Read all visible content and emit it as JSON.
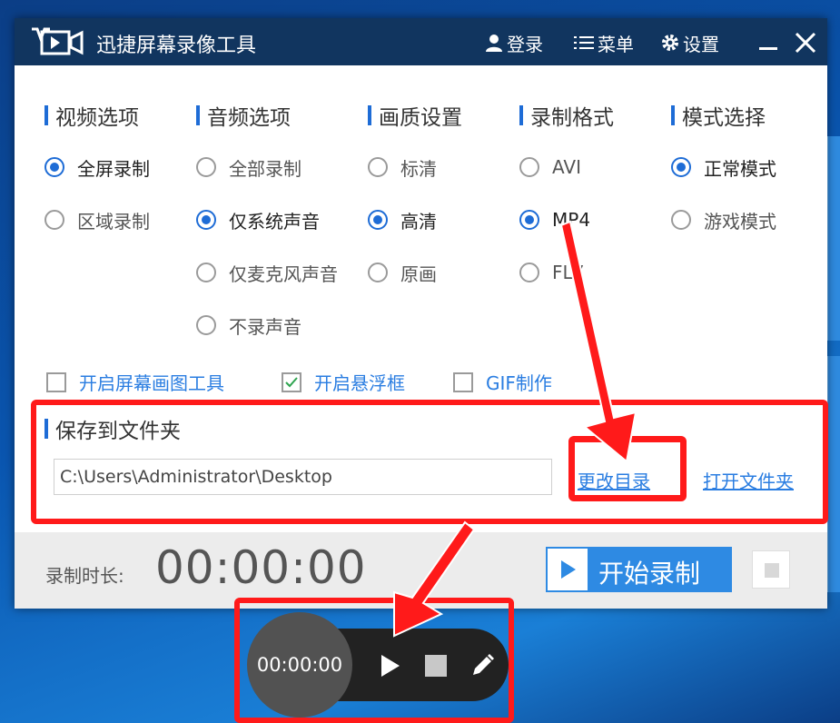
{
  "app": {
    "title": "迅捷屏幕录像工具",
    "login": "登录",
    "menu": "菜单",
    "settings": "设置"
  },
  "columns": [
    {
      "title": "视频选项",
      "options": [
        {
          "label": "全屏录制",
          "selected": true
        },
        {
          "label": "区域录制",
          "selected": false
        }
      ]
    },
    {
      "title": "音频选项",
      "options": [
        {
          "label": "全部录制",
          "selected": false
        },
        {
          "label": "仅系统声音",
          "selected": true
        },
        {
          "label": "仅麦克风声音",
          "selected": false
        },
        {
          "label": "不录声音",
          "selected": false
        }
      ]
    },
    {
      "title": "画质设置",
      "options": [
        {
          "label": "标清",
          "selected": false
        },
        {
          "label": "高清",
          "selected": true
        },
        {
          "label": "原画",
          "selected": false
        }
      ]
    },
    {
      "title": "录制格式",
      "options": [
        {
          "label": "AVI",
          "selected": false
        },
        {
          "label": "MP4",
          "selected": true
        },
        {
          "label": "FLV",
          "selected": false
        }
      ]
    },
    {
      "title": "模式选择",
      "options": [
        {
          "label": "正常模式",
          "selected": true
        },
        {
          "label": "游戏模式",
          "selected": false
        }
      ]
    }
  ],
  "checkboxes": [
    {
      "label": "开启屏幕画图工具",
      "checked": false
    },
    {
      "label": "开启悬浮框",
      "checked": true
    },
    {
      "label": "GIF制作",
      "checked": false
    }
  ],
  "save": {
    "title": "保存到文件夹",
    "path": "C:\\Users\\Administrator\\Desktop",
    "change_dir": "更改目录",
    "open_folder": "打开文件夹"
  },
  "footer": {
    "duration_label": "录制时长:",
    "duration_value": "00:00:00",
    "start_label": "开始录制"
  },
  "floating": {
    "time": "00:00:00"
  },
  "colors": {
    "titlebar": "#11355f",
    "accent": "#1e6cd6",
    "link": "#2a7de1",
    "start_button": "#2e8ae3",
    "annotation": "#ff1a1a"
  }
}
